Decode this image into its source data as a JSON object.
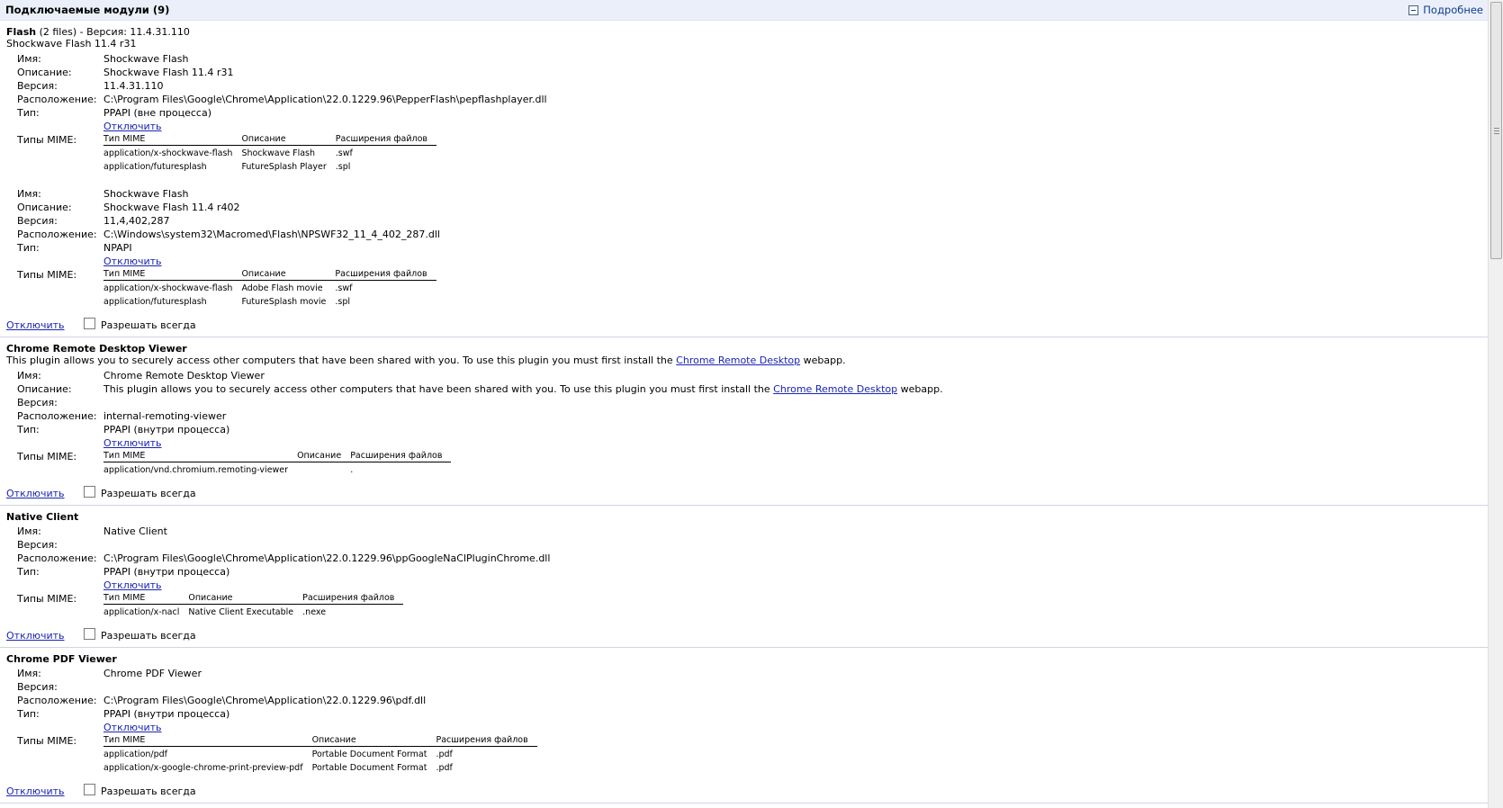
{
  "header": {
    "title": "Подключаемые модули (9)",
    "details_label": "Подробнее"
  },
  "labels": {
    "name": "Имя:",
    "description": "Описание:",
    "version": "Версия:",
    "location": "Расположение:",
    "type": "Тип:",
    "mime_types": "Типы MIME:",
    "mime_type_col": "Тип MIME",
    "mime_desc_col": "Описание",
    "mime_ext_col": "Расширения файлов",
    "disable": "Отключить",
    "always_allow": "Разрешать всегда"
  },
  "plugins": [
    {
      "name": "Flash",
      "name_suffix": " (2 files) - Версия: 11.4.31.110",
      "description": "Shockwave Flash 11.4 r31",
      "entries": [
        {
          "name": "Shockwave Flash",
          "description": "Shockwave Flash 11.4 r31",
          "version": "11.4.31.110",
          "location": "C:\\Program Files\\Google\\Chrome\\Application\\22.0.1229.96\\PepperFlash\\pepflashplayer.dll",
          "type": "PPAPI (вне процесса)",
          "mime": [
            {
              "type": "application/x-shockwave-flash",
              "desc": "Shockwave Flash",
              "ext": ".swf"
            },
            {
              "type": "application/futuresplash",
              "desc": "FutureSplash Player",
              "ext": ".spl"
            }
          ]
        },
        {
          "name": "Shockwave Flash",
          "description": "Shockwave Flash 11.4 r402",
          "version": "11,4,402,287",
          "location": "C:\\Windows\\system32\\Macromed\\Flash\\NPSWF32_11_4_402_287.dll",
          "type": "NPAPI",
          "mime": [
            {
              "type": "application/x-shockwave-flash",
              "desc": "Adobe Flash movie",
              "ext": ".swf"
            },
            {
              "type": "application/futuresplash",
              "desc": "FutureSplash movie",
              "ext": ".spl"
            }
          ]
        }
      ]
    },
    {
      "name": "Chrome Remote Desktop Viewer",
      "desc_pre": "This plugin allows you to securely access other computers that have been shared with you. To use this plugin you must first install the ",
      "desc_link": "Chrome Remote Desktop",
      "desc_post": " webapp.",
      "entry": {
        "name": "Chrome Remote Desktop Viewer",
        "version": "",
        "location": "internal-remoting-viewer",
        "type": "PPAPI (внутри процесса)",
        "mime": [
          {
            "type": "application/vnd.chromium.remoting-viewer",
            "desc": "",
            "ext": "."
          }
        ]
      }
    },
    {
      "name": "Native Client",
      "entry": {
        "name": "Native Client",
        "version": "",
        "location": "C:\\Program Files\\Google\\Chrome\\Application\\22.0.1229.96\\ppGoogleNaClPluginChrome.dll",
        "type": "PPAPI (внутри процесса)",
        "mime": [
          {
            "type": "application/x-nacl",
            "desc": "Native Client Executable",
            "ext": ".nexe"
          }
        ]
      }
    },
    {
      "name": "Chrome PDF Viewer",
      "entry": {
        "name": "Chrome PDF Viewer",
        "version": "",
        "location": "C:\\Program Files\\Google\\Chrome\\Application\\22.0.1229.96\\pdf.dll",
        "type": "PPAPI (внутри процесса)",
        "mime": [
          {
            "type": "application/pdf",
            "desc": "Portable Document Format",
            "ext": ".pdf"
          },
          {
            "type": "application/x-google-chrome-print-preview-pdf",
            "desc": "Portable Document Format",
            "ext": ".pdf"
          }
        ]
      }
    }
  ]
}
